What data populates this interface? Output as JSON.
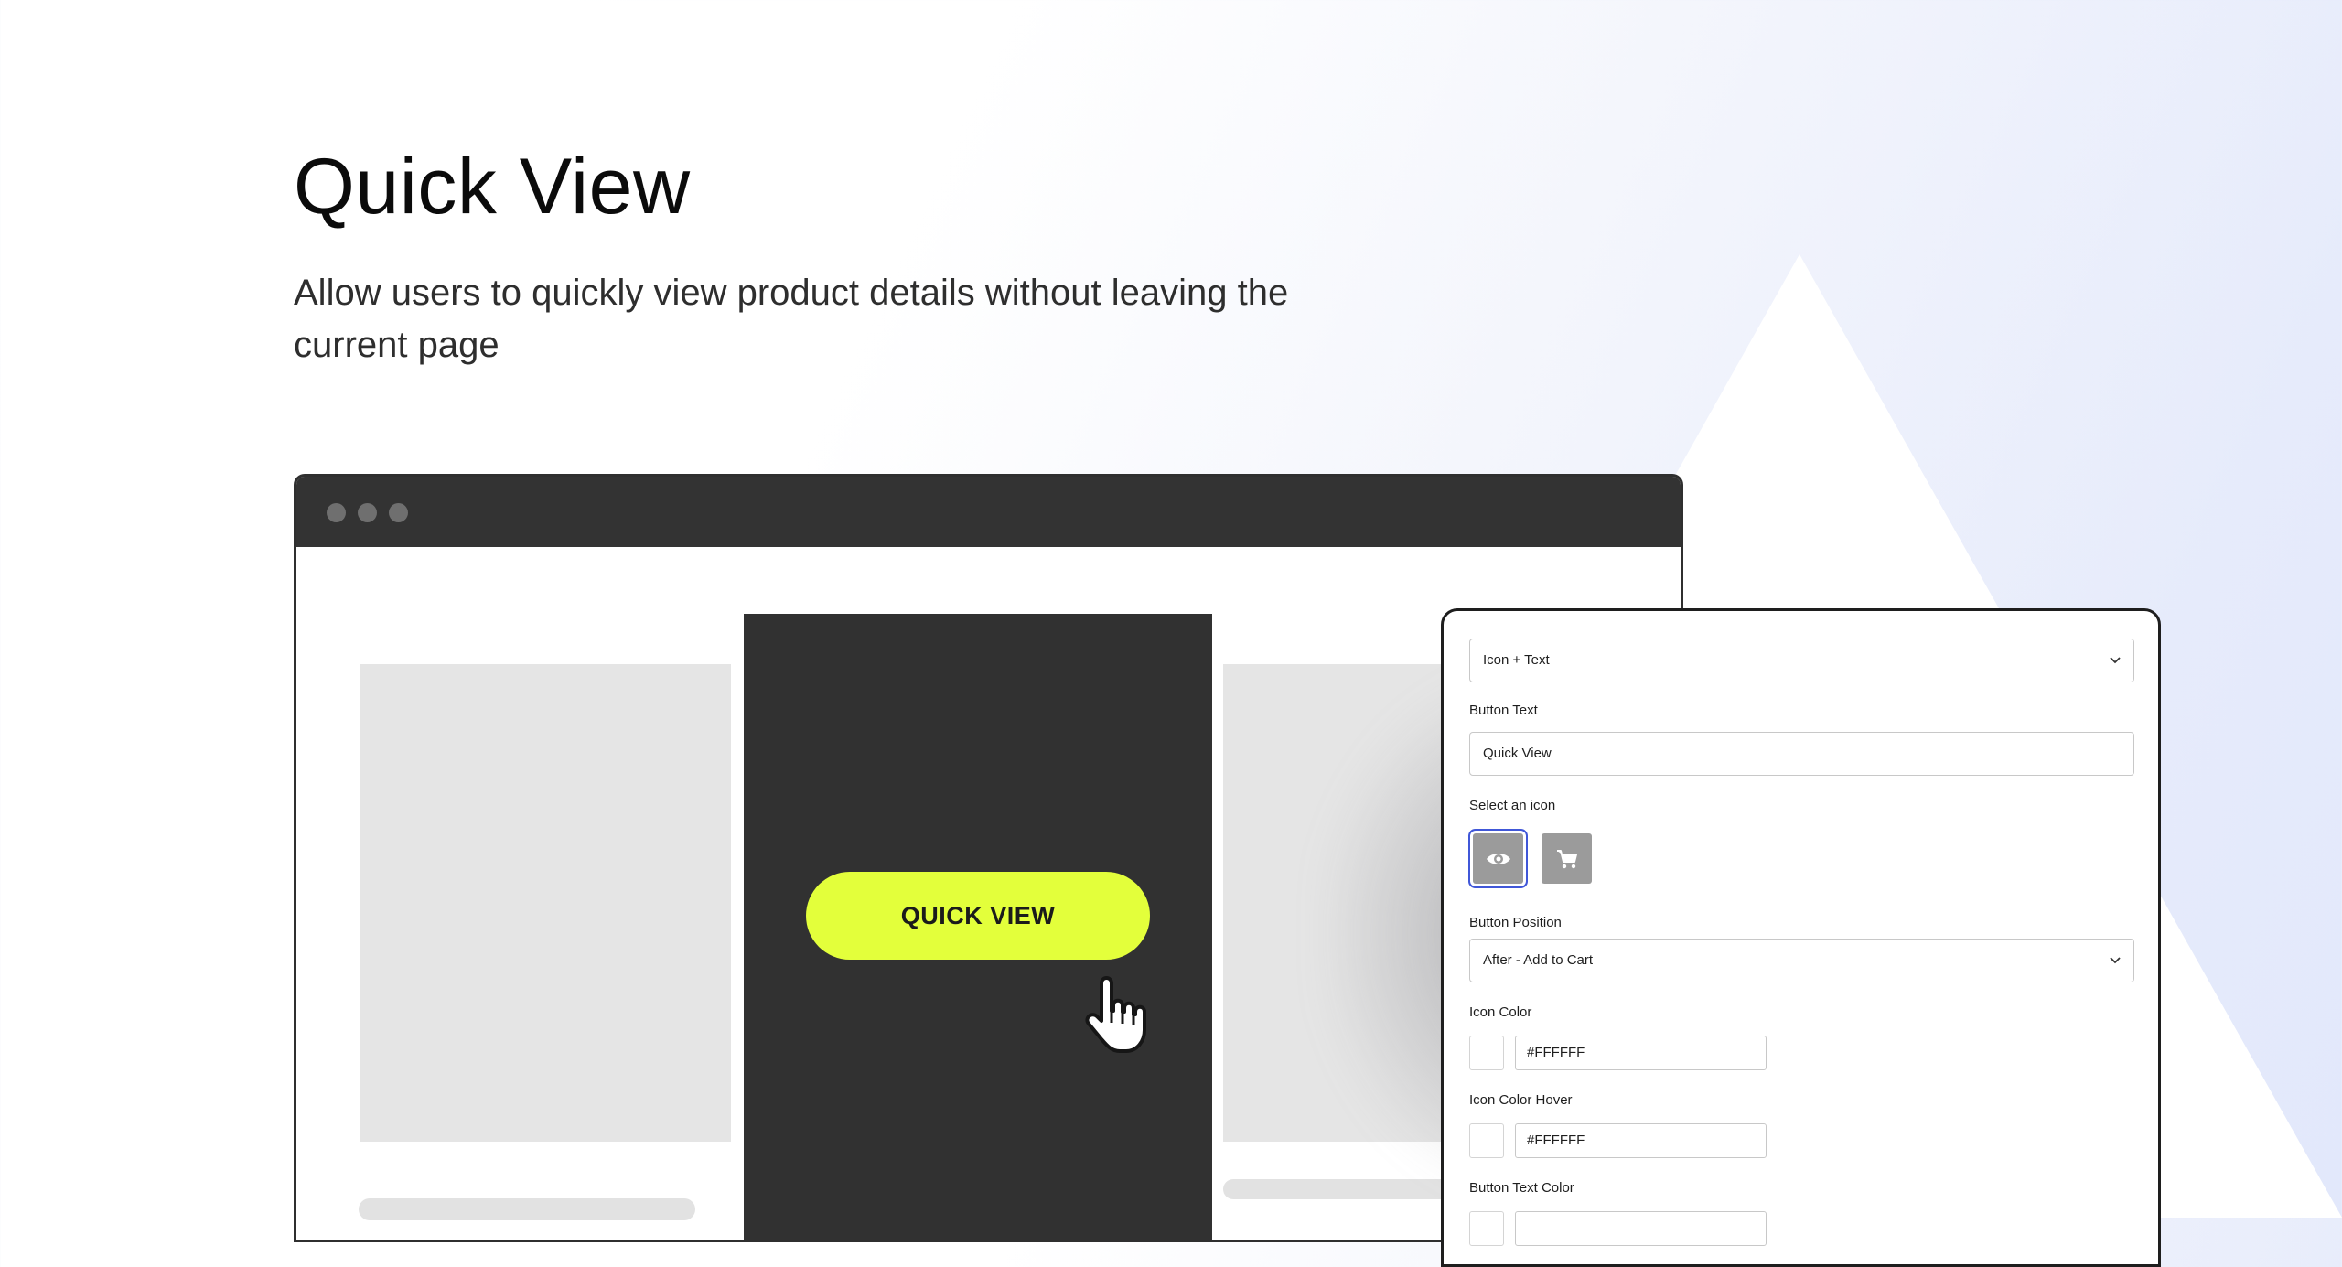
{
  "hero": {
    "title": "Quick View",
    "subtitle": "Allow users to quickly view product details without leaving the current page"
  },
  "mockup": {
    "quick_view_button": "QUICK VIEW"
  },
  "settings": {
    "display_type": {
      "value": "Icon + Text"
    },
    "button_text": {
      "label": "Button Text",
      "value": "Quick View"
    },
    "select_icon": {
      "label": "Select an icon",
      "options": [
        "eye-icon",
        "cart-icon"
      ],
      "selected": "eye-icon"
    },
    "button_position": {
      "label": "Button Position",
      "value": "After - Add to Cart"
    },
    "icon_color": {
      "label": "Icon Color",
      "value": "#FFFFFF"
    },
    "icon_color_hover": {
      "label": "Icon Color Hover",
      "value": "#FFFFFF"
    },
    "button_text_color": {
      "label": "Button Text Color"
    }
  },
  "colors": {
    "accent_button": "#E3FF3B",
    "browser_chrome": "#333333",
    "selected_outline": "#4057D8"
  }
}
